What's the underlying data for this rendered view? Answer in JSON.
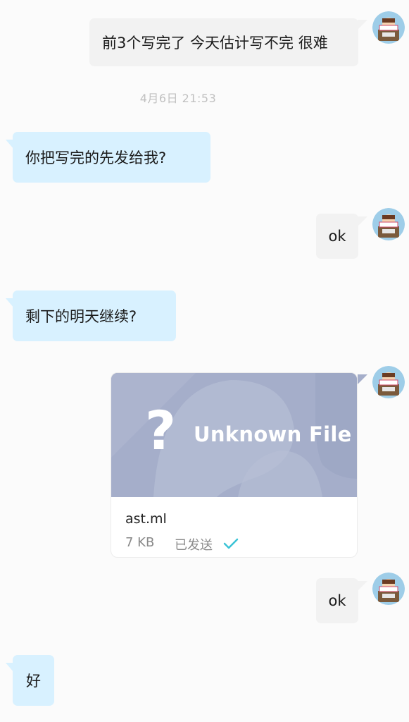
{
  "messages": {
    "m1": "前3个写完了 今天估计写不完 很难",
    "m2": "你把写完的先发给我?",
    "m3": "ok",
    "m4": "剩下的明天继续?",
    "m5": "ok",
    "m6": "好"
  },
  "timestamp": "4月6日  21:53",
  "file": {
    "preview_label": "Unknown File",
    "preview_icon": "question-mark-icon",
    "name": "ast.ml",
    "size": "7 KB",
    "status": "已发送",
    "status_icon": "check-icon"
  },
  "colors": {
    "incoming_bubble": "#d8f1ff",
    "outgoing_bubble": "#f2f2f2",
    "file_preview_bg": "#a5aeca",
    "check": "#3ac3d6"
  }
}
